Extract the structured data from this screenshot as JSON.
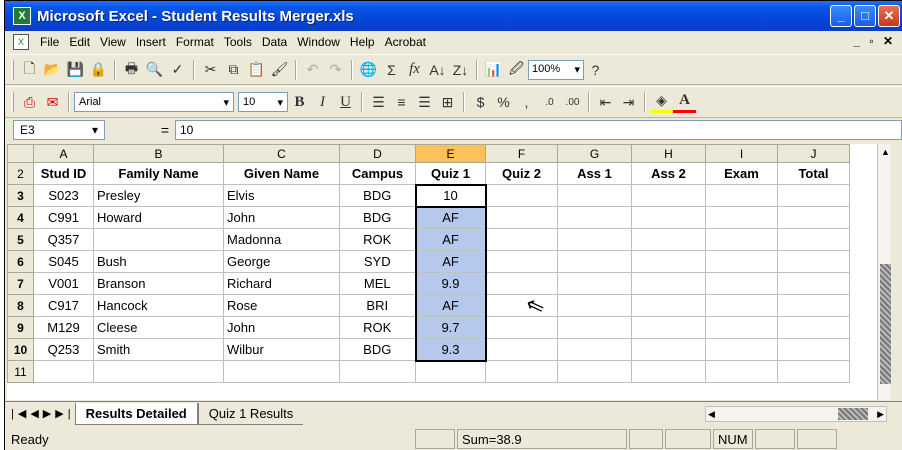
{
  "window": {
    "title": "Microsoft Excel - Student Results Merger.xls"
  },
  "menu": [
    "File",
    "Edit",
    "View",
    "Insert",
    "Format",
    "Tools",
    "Data",
    "Window",
    "Help",
    "Acrobat"
  ],
  "toolbar": {
    "zoom": "100%",
    "font_name": "Arial",
    "font_size": "10"
  },
  "formula": {
    "name_box": "E3",
    "equals": "=",
    "value": "10"
  },
  "columns": [
    "A",
    "B",
    "C",
    "D",
    "E",
    "F",
    "G",
    "H",
    "I",
    "J"
  ],
  "rows": [
    {
      "num": "2",
      "cells": [
        "Stud ID",
        "Family Name",
        "Given Name",
        "Campus",
        "Quiz 1",
        "Quiz 2",
        "Ass 1",
        "Ass 2",
        "Exam",
        "Total"
      ]
    },
    {
      "num": "3",
      "cells": [
        "S023",
        "Presley",
        "Elvis",
        "BDG",
        "10",
        "",
        "",
        "",
        "",
        ""
      ]
    },
    {
      "num": "4",
      "cells": [
        "C991",
        "Howard",
        "John",
        "BDG",
        "AF",
        "",
        "",
        "",
        "",
        ""
      ]
    },
    {
      "num": "5",
      "cells": [
        "Q357",
        "",
        "Madonna",
        "ROK",
        "AF",
        "",
        "",
        "",
        "",
        ""
      ]
    },
    {
      "num": "6",
      "cells": [
        "S045",
        "Bush",
        "George",
        "SYD",
        "AF",
        "",
        "",
        "",
        "",
        ""
      ]
    },
    {
      "num": "7",
      "cells": [
        "V001",
        "Branson",
        "Richard",
        "MEL",
        "9.9",
        "",
        "",
        "",
        "",
        ""
      ]
    },
    {
      "num": "8",
      "cells": [
        "C917",
        "Hancock",
        "Rose",
        "BRI",
        "AF",
        "",
        "",
        "",
        "",
        ""
      ]
    },
    {
      "num": "9",
      "cells": [
        "M129",
        "Cleese",
        "John",
        "ROK",
        "9.7",
        "",
        "",
        "",
        "",
        ""
      ]
    },
    {
      "num": "10",
      "cells": [
        "Q253",
        "Smith",
        "Wilbur",
        "BDG",
        "9.3",
        "",
        "",
        "",
        "",
        ""
      ]
    },
    {
      "num": "11",
      "cells": [
        "",
        "",
        "",
        "",
        "",
        "",
        "",
        "",
        "",
        ""
      ]
    }
  ],
  "sheet_tabs": [
    "Results Detailed",
    "Quiz 1 Results"
  ],
  "status": {
    "mode": "Ready",
    "sum": "Sum=38.9",
    "num": "NUM"
  },
  "colors": {
    "title_bar": "#0a57e6",
    "selection": "#b6c8ec",
    "active_header": "#ffc05b"
  }
}
